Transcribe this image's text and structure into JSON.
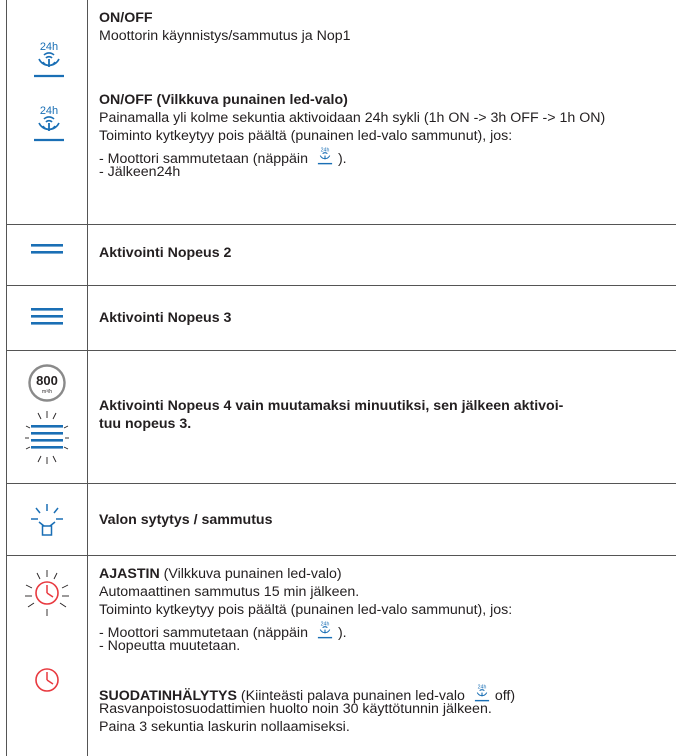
{
  "rows": {
    "onoff": {
      "title": "ON/OFF",
      "desc": "Moottorin käynnistys/sammutus ja Nop1"
    },
    "onoff_blink": {
      "title": "ON/OFF (Vilkkuva punainen led-valo)",
      "line1": "Painamalla yli kolme sekuntia aktivoidaan 24h sykli (1h ON -> 3h OFF -> 1h ON)",
      "line2": "Toiminto kytkeytyy pois päältä (punainen led-valo sammunut), jos:",
      "line3_pre": "- Moottori sammutetaan (näppäin",
      "line3_post": ").",
      "line4": "- Jälkeen24h"
    },
    "speed2": {
      "title": "Aktivointi Nopeus 2"
    },
    "speed3": {
      "title": "Aktivointi Nopeus 3"
    },
    "speed4": {
      "badge_value": "800",
      "badge_unit": "m³/h",
      "line1": "Aktivointi Nopeus 4 vain muutamaksi minuutiksi, sen jälkeen aktivoi-",
      "line2": "tuu nopeus 3."
    },
    "light": {
      "title": "Valon sytytys / sammutus"
    },
    "timer": {
      "title": "AJASTIN",
      "title_suffix": " (Vilkkuva punainen led-valo)",
      "line1": "Automaattinen sammutus 15 min jälkeen.",
      "line2": "Toiminto kytkeytyy pois päältä (punainen led-valo sammunut), jos:",
      "line3_pre": "- Moottori sammutetaan (näppäin",
      "line3_post": ").",
      "line4": "- Nopeutta muutetaan."
    },
    "filter": {
      "title": "SUODATINHÄLYTYS",
      "title_suffix_pre": "  (Kiinteästi palava punainen led-valo",
      "title_suffix_post": "off)",
      "line1": "Rasvanpoistosuodattimien huolto noin 30 käyttötunnin jälkeen.",
      "line2": "Paina 3 sekuntia laskurin nollaamiseksi."
    }
  },
  "icons": {
    "power_label": "24h",
    "colors": {
      "blue": "#1a6fb5",
      "red": "#e8393f",
      "border": "#555555"
    }
  }
}
